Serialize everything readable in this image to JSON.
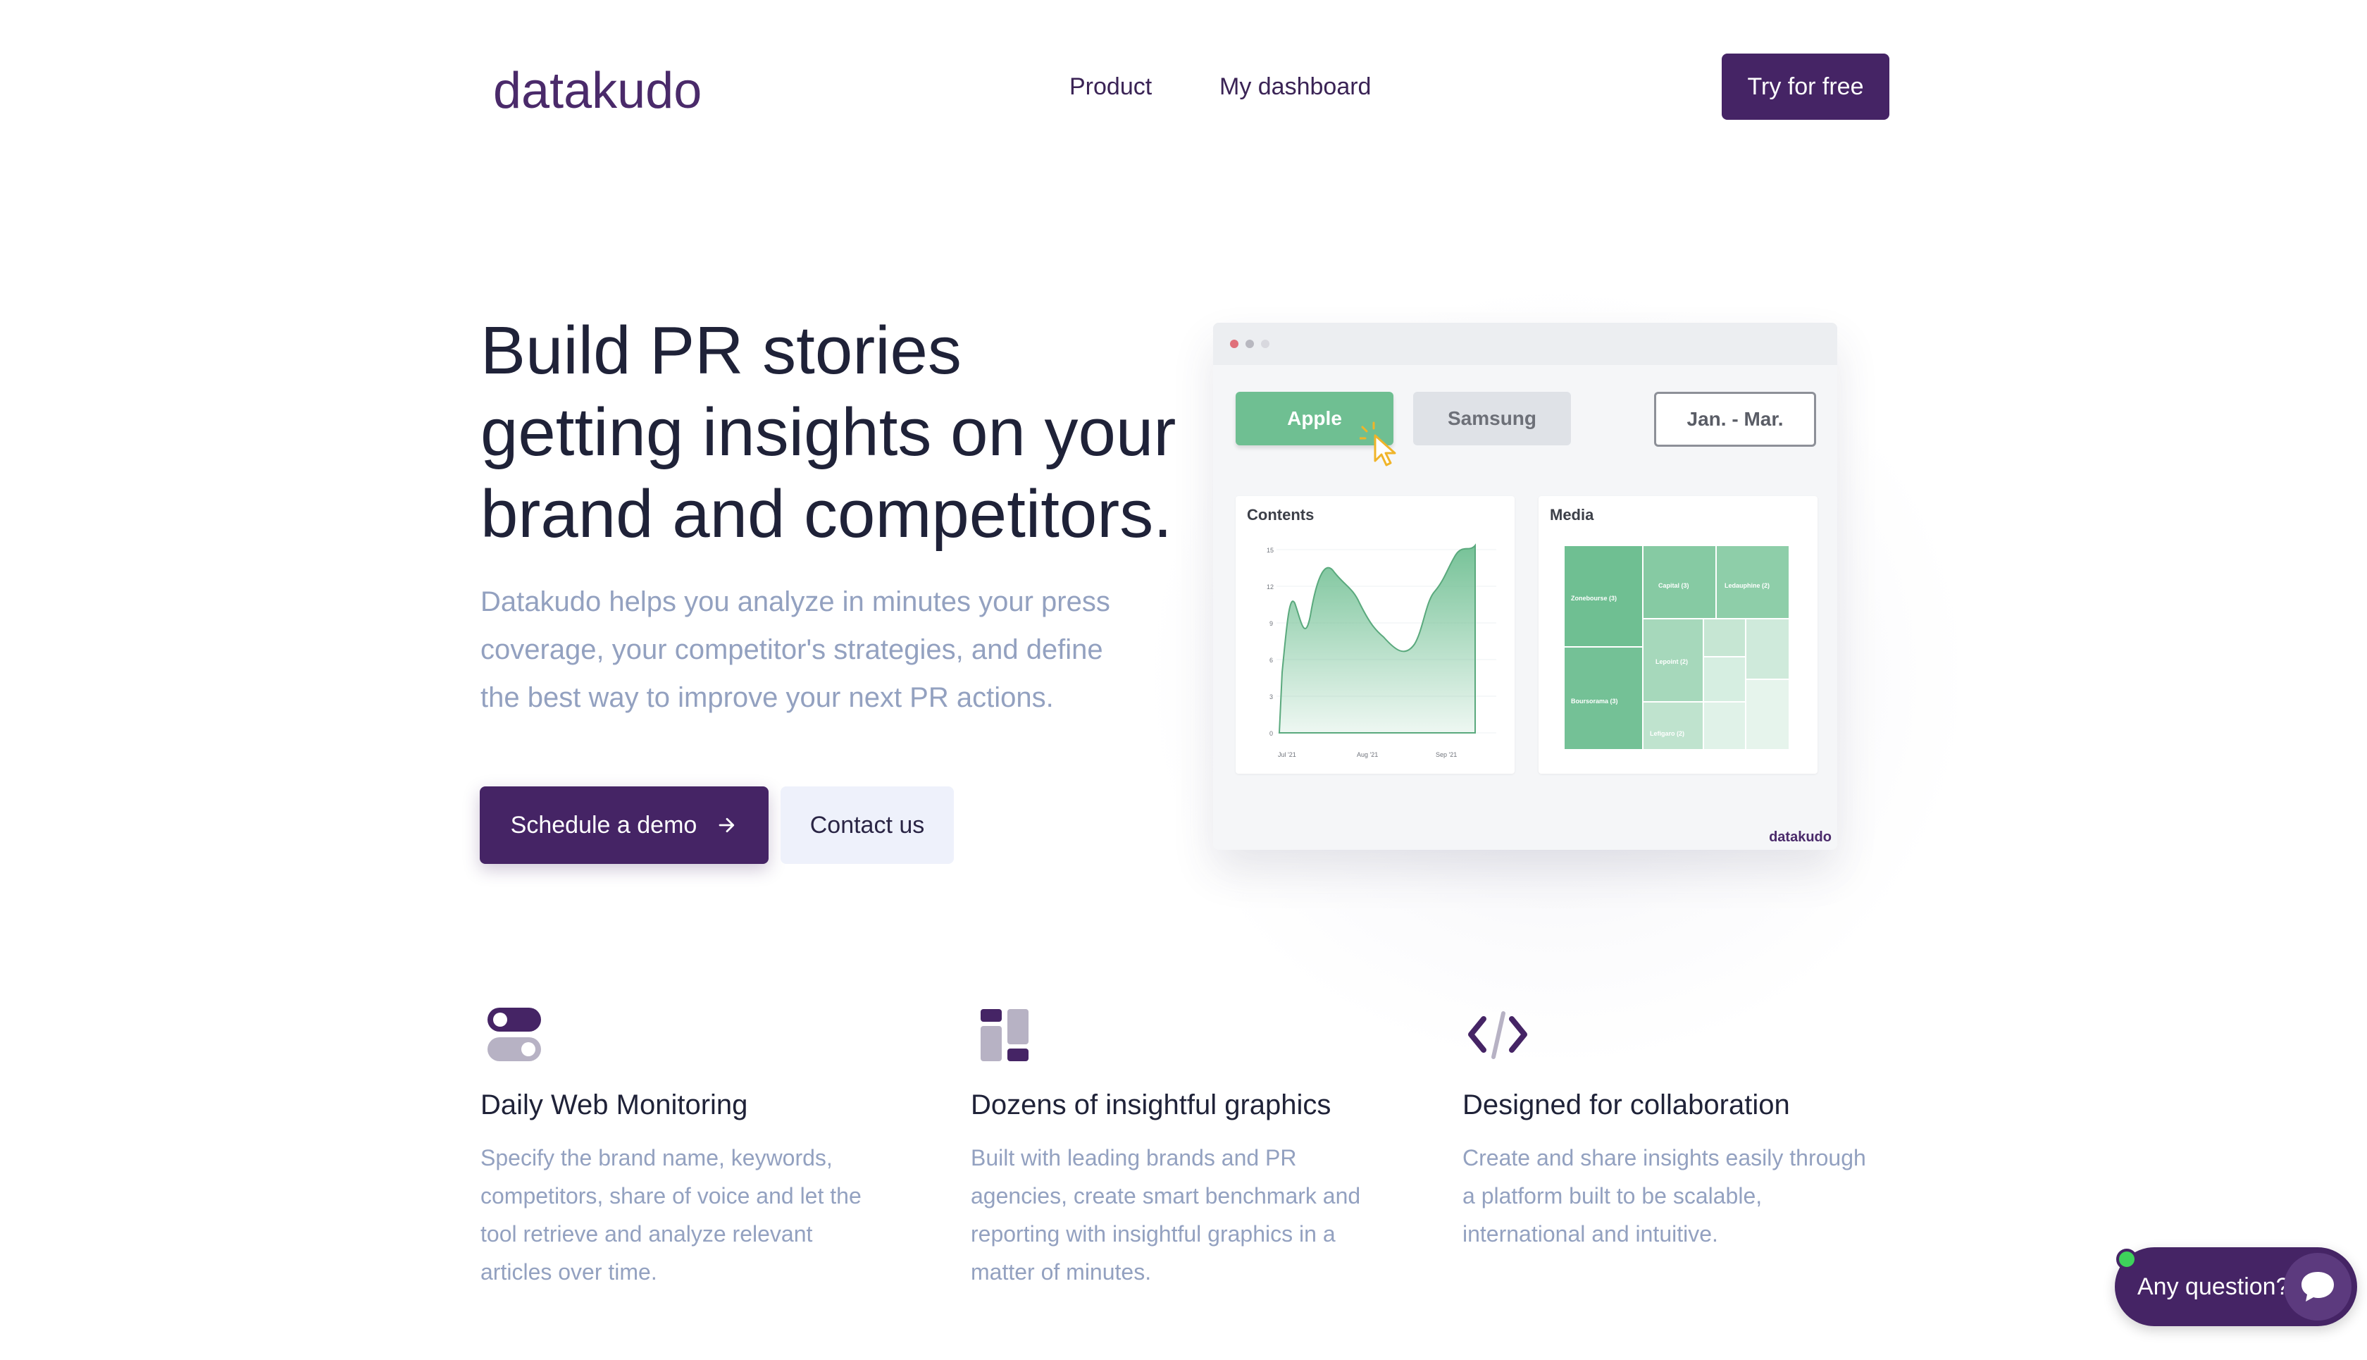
{
  "header": {
    "logo": "datakudo",
    "nav": [
      "Product",
      "My dashboard"
    ],
    "cta_label": "Try for free"
  },
  "hero": {
    "headline_lines": [
      "Build PR stories",
      "getting insights on your",
      "brand and competitors."
    ],
    "subtitle_lines": [
      "Datakudo helps you analyze in minutes your press",
      "coverage, your competitor's strategies, and define",
      "the best way to improve your next PR actions."
    ],
    "primary_button": "Schedule a demo",
    "primary_button_icon": "arrow-right-icon",
    "secondary_button": "Contact us"
  },
  "mockup": {
    "tabs": [
      "Apple",
      "Samsung"
    ],
    "date_range": "Jan. - Mar.",
    "contents_title": "Contents",
    "media_title": "Media",
    "footer_logo": "datakudo",
    "contents_chart": {
      "y_ticks": [
        "15",
        "12",
        "9",
        "6",
        "3",
        "0"
      ],
      "x_ticks": [
        "Jul '21",
        "Aug '21",
        "Sep '21"
      ]
    },
    "media_treemap": [
      "Zonebourse (3)",
      "Capital (3)",
      "Ledauphine (2)",
      "Lepoint (2)",
      "Boursorama (3)",
      "Lefigaro (2)"
    ]
  },
  "features": [
    {
      "icon": "toggle-switch-icon",
      "title": "Daily Web Monitoring",
      "desc_lines": [
        "Specify the brand name, keywords,",
        "competitors, share of voice and let the",
        "tool retrieve and analyze relevant",
        "articles over time."
      ]
    },
    {
      "icon": "dashboard-blocks-icon",
      "title": "Dozens of insightful graphics",
      "desc_lines": [
        "Built with leading brands and PR",
        "agencies, create smart benchmark and",
        "reporting with insightful graphics in a",
        "matter of minutes."
      ]
    },
    {
      "icon": "code-brackets-icon",
      "title": "Designed for collaboration",
      "desc_lines": [
        "Create and share insights easily through",
        "a platform built to be scalable,",
        "international and intuitive."
      ]
    }
  ],
  "chat": {
    "label": "Any question?",
    "icon": "chat-bubble-icon"
  },
  "colors": {
    "brand": "#452465",
    "accent_green": "#6fbf92",
    "muted_text": "#93a1c0"
  }
}
